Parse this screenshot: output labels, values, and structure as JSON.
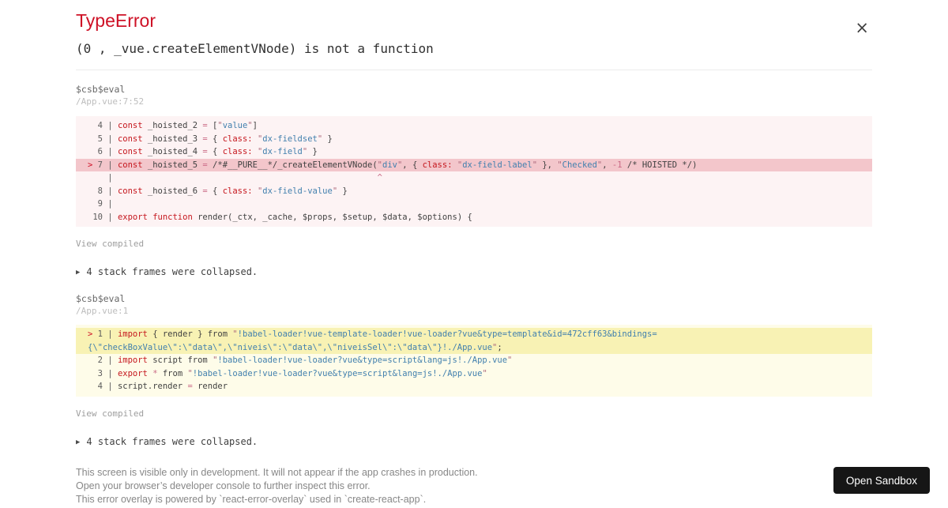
{
  "icons": {
    "close": "×",
    "expand": "▶"
  },
  "colors": {
    "accent_red": "#ce1126",
    "code_error_bg": "#fdf3f4",
    "code_error_highlight": "#f3c6cb",
    "code_warning_bg": "#fefce9",
    "code_warning_highlight": "#f8f2b4",
    "button_bg": "#161616"
  },
  "header": {
    "title": "TypeError",
    "message": "(0 , _vue.createElementVNode) is not a function"
  },
  "frames": [
    {
      "fn": "$csb$eval",
      "loc": "/App.vue:7:52",
      "view_compiled": "View compiled",
      "collapsed": "4 stack frames were collapsed.",
      "block": {
        "variant": "error",
        "rows": [
          {
            "hl": false,
            "tokens": [
              [
                "  4 | ",
                "g"
              ],
              [
                "const",
                "k"
              ],
              [
                " _hoisted_2 ",
                "p"
              ],
              [
                "=",
                "o"
              ],
              [
                " [",
                "p"
              ],
              [
                "\"",
                "q"
              ],
              [
                "value",
                "s"
              ],
              [
                "\"",
                "q"
              ],
              [
                "]",
                "p"
              ]
            ]
          },
          {
            "hl": false,
            "tokens": [
              [
                "  5 | ",
                "g"
              ],
              [
                "const",
                "k"
              ],
              [
                " _hoisted_3 ",
                "p"
              ],
              [
                "=",
                "o"
              ],
              [
                " { ",
                "p"
              ],
              [
                "class:",
                "k"
              ],
              [
                " ",
                "p"
              ],
              [
                "\"",
                "q"
              ],
              [
                "dx-fieldset",
                "s"
              ],
              [
                "\"",
                "q"
              ],
              [
                " }",
                "p"
              ]
            ]
          },
          {
            "hl": false,
            "tokens": [
              [
                "  6 | ",
                "g"
              ],
              [
                "const",
                "k"
              ],
              [
                " _hoisted_4 ",
                "p"
              ],
              [
                "=",
                "o"
              ],
              [
                " { ",
                "p"
              ],
              [
                "class:",
                "k"
              ],
              [
                " ",
                "p"
              ],
              [
                "\"",
                "q"
              ],
              [
                "dx-field",
                "s"
              ],
              [
                "\"",
                "q"
              ],
              [
                " }",
                "p"
              ]
            ]
          },
          {
            "hl": true,
            "tokens": [
              [
                ">",
                "m"
              ],
              [
                " 7 | ",
                "g"
              ],
              [
                "const",
                "k"
              ],
              [
                " _hoisted_5 ",
                "p"
              ],
              [
                "=",
                "o"
              ],
              [
                " /*#__PURE__*/_createElementVNode(",
                "p"
              ],
              [
                "\"",
                "q"
              ],
              [
                "div",
                "s"
              ],
              [
                "\"",
                "q"
              ],
              [
                ", { ",
                "p"
              ],
              [
                "class:",
                "k"
              ],
              [
                " ",
                "p"
              ],
              [
                "\"",
                "q"
              ],
              [
                "dx-field-label",
                "s"
              ],
              [
                "\"",
                "q"
              ],
              [
                " }, ",
                "p"
              ],
              [
                "\"",
                "q"
              ],
              [
                "Checked",
                "s"
              ],
              [
                "\"",
                "q"
              ],
              [
                ", ",
                "p"
              ],
              [
                "-1",
                "o"
              ],
              [
                " /* HOISTED */)",
                "p"
              ]
            ]
          },
          {
            "hl": false,
            "tokens": [
              [
                "    | ",
                "g"
              ],
              [
                " ",
                "p",
                52
              ],
              [
                "^",
                "o"
              ]
            ]
          },
          {
            "hl": false,
            "tokens": [
              [
                "  8 | ",
                "g"
              ],
              [
                "const",
                "k"
              ],
              [
                " _hoisted_6 ",
                "p"
              ],
              [
                "=",
                "o"
              ],
              [
                " { ",
                "p"
              ],
              [
                "class:",
                "k"
              ],
              [
                " ",
                "p"
              ],
              [
                "\"",
                "q"
              ],
              [
                "dx-field-value",
                "s"
              ],
              [
                "\"",
                "q"
              ],
              [
                " }",
                "p"
              ]
            ]
          },
          {
            "hl": false,
            "tokens": [
              [
                "  9 | ",
                "g"
              ]
            ]
          },
          {
            "hl": false,
            "tokens": [
              [
                " 10 | ",
                "g"
              ],
              [
                "export",
                "k"
              ],
              [
                " ",
                "p"
              ],
              [
                "function",
                "k"
              ],
              [
                " render(_ctx, _cache, $props, $setup, $data, $options) {",
                "p"
              ]
            ]
          }
        ]
      }
    },
    {
      "fn": "$csb$eval",
      "loc": "/App.vue:1",
      "view_compiled": "View compiled",
      "collapsed": "4 stack frames were collapsed.",
      "block": {
        "variant": "warning",
        "rows": [
          {
            "hl": true,
            "tokens": [
              [
                ">",
                "m"
              ],
              [
                " 1 | ",
                "g"
              ],
              [
                "import",
                "k"
              ],
              [
                " { render } from ",
                "p"
              ],
              [
                "\"",
                "q"
              ],
              [
                "!babel-loader!vue-template-loader!vue-loader?vue&type=template&id=472cff63&bindings=",
                "s"
              ]
            ]
          },
          {
            "hl": true,
            "tokens": [
              [
                "{\\\"checkBoxValue\\\":\\\"data\\\",\\\"niveis\\\":\\\"data\\\",\\\"niveisSel\\\":\\\"data\\\"}!./App.vue",
                "s"
              ],
              [
                "\"",
                "q"
              ],
              [
                ";",
                "p"
              ]
            ]
          },
          {
            "hl": false,
            "tokens": [
              [
                "  2 | ",
                "g"
              ],
              [
                "import",
                "k"
              ],
              [
                " script from ",
                "p"
              ],
              [
                "\"",
                "q"
              ],
              [
                "!babel-loader!vue-loader?vue&type=script&lang=js!./App.vue",
                "s"
              ],
              [
                "\"",
                "q"
              ]
            ]
          },
          {
            "hl": false,
            "tokens": [
              [
                "  3 | ",
                "g"
              ],
              [
                "export",
                "k"
              ],
              [
                " ",
                "p"
              ],
              [
                "*",
                "o"
              ],
              [
                " from ",
                "p"
              ],
              [
                "\"",
                "q"
              ],
              [
                "!babel-loader!vue-loader?vue&type=script&lang=js!./App.vue",
                "s"
              ],
              [
                "\"",
                "q"
              ]
            ]
          },
          {
            "hl": false,
            "tokens": [
              [
                "  4 | ",
                "g"
              ],
              [
                "script.render ",
                "p"
              ],
              [
                "=",
                "o"
              ],
              [
                " render",
                "p"
              ]
            ]
          }
        ]
      }
    }
  ],
  "footer": {
    "lines": [
      "This screen is visible only in development. It will not appear if the app crashes in production.",
      "Open your browser’s developer console to further inspect this error.",
      "This error overlay is powered by `react-error-overlay` used in `create-react-app`."
    ],
    "open_sandbox": "Open Sandbox"
  }
}
